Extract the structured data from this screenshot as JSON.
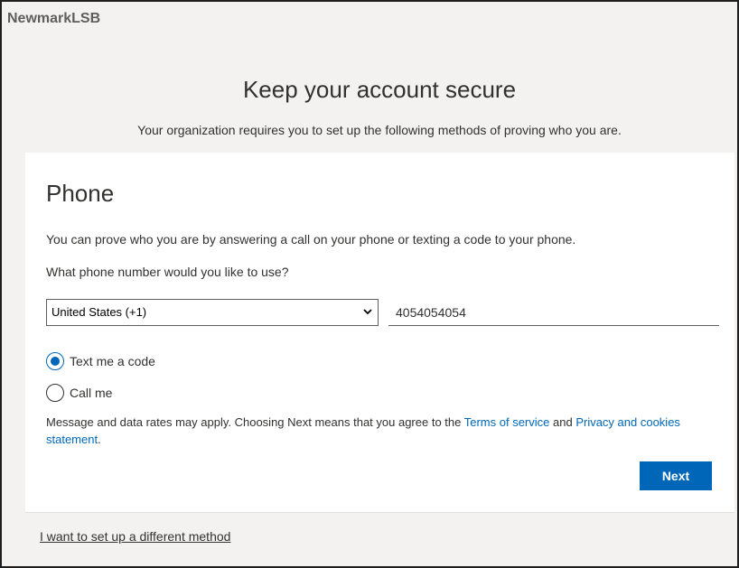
{
  "header": {
    "brand": "NewmarkLSB"
  },
  "page": {
    "title": "Keep your account secure",
    "subtitle": "Your organization requires you to set up the following methods of proving who you are."
  },
  "card": {
    "title": "Phone",
    "description": "You can prove who you are by answering a call on your phone or texting a code to your phone.",
    "question": "What phone number would you like to use?",
    "country_select": {
      "selected": "United States (+1)"
    },
    "phone_input": {
      "value": "4054054054"
    },
    "options": [
      {
        "label": "Text me a code",
        "checked": true
      },
      {
        "label": "Call me",
        "checked": false
      }
    ],
    "legal": {
      "prefix": "Message and data rates may apply. Choosing Next means that you agree to the ",
      "terms_link": "Terms of service",
      "middle": " and ",
      "privacy_link": "Privacy and cookies statement",
      "suffix": "."
    },
    "next_label": "Next"
  },
  "footer": {
    "alt_method_link": "I want to set up a different method"
  },
  "colors": {
    "accent": "#0067b8",
    "background": "#f3f2f1",
    "text": "#323130"
  },
  "icons": {
    "select_chevron": "chevron-down-icon"
  }
}
